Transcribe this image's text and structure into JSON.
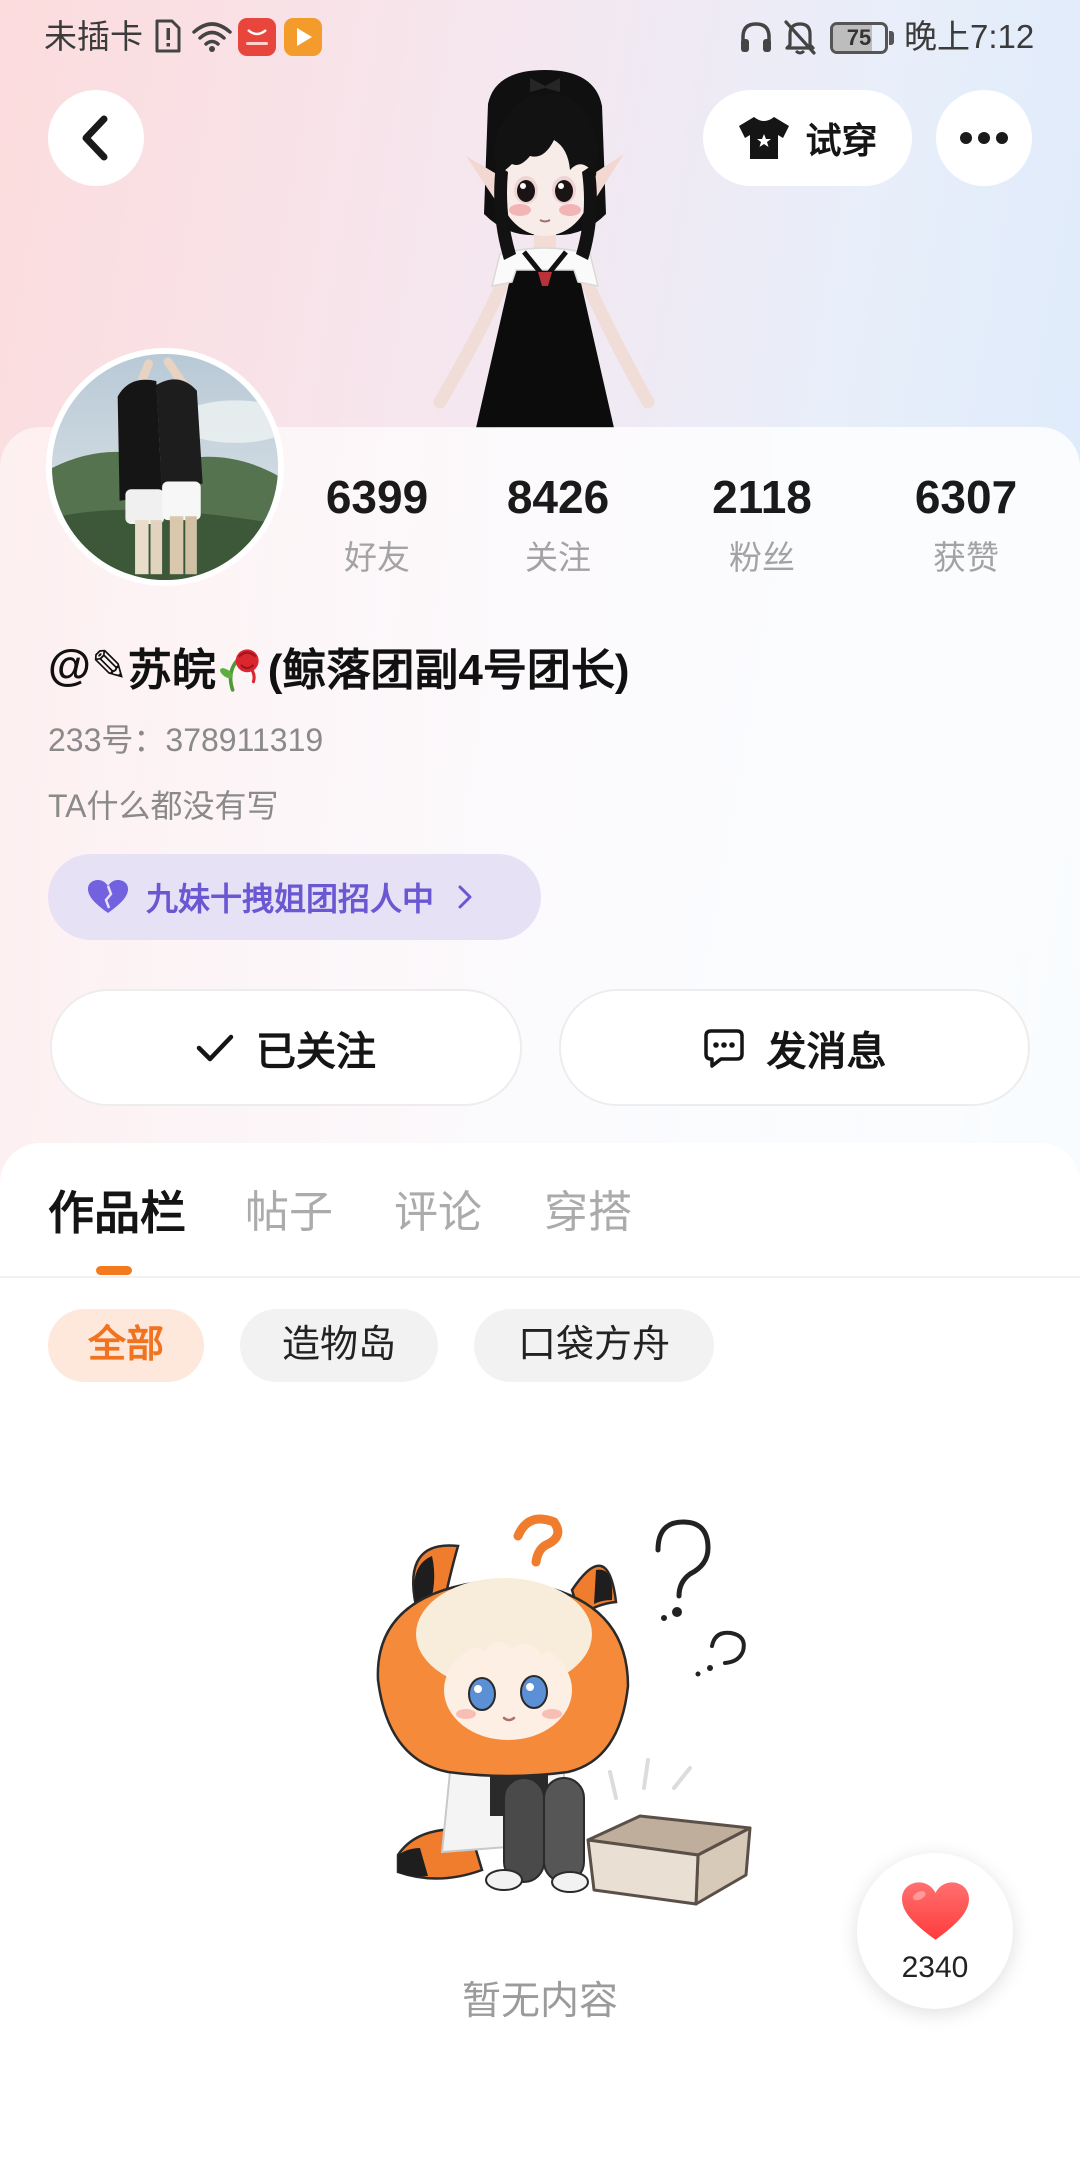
{
  "status_bar": {
    "carrier": "未插卡",
    "battery_level": "75",
    "time": "晚上7:12",
    "left_icons": [
      "sim-alert-icon",
      "wifi-icon",
      "huawei-appgallery-icon",
      "video-app-icon"
    ],
    "right_icons": [
      "headphones-icon",
      "notifications-off-icon",
      "battery-icon"
    ]
  },
  "header": {
    "back_icon": "chevron-left-icon",
    "try_on": {
      "icon": "tshirt-icon",
      "label": "试穿"
    },
    "more_icon": "more-dots-icon"
  },
  "profile": {
    "stats": [
      {
        "value": "6399",
        "label": "好友"
      },
      {
        "value": "8426",
        "label": "关注"
      },
      {
        "value": "2118",
        "label": "粉丝"
      },
      {
        "value": "6307",
        "label": "获赞"
      }
    ],
    "name": {
      "at": "@",
      "pencil": "✎",
      "main": "苏皖",
      "rose_icon": "wilted-rose-icon",
      "suffix": "(鲸落团副4号团长)"
    },
    "id_line": "233号：378911319",
    "bio": "TA什么都没有写",
    "group_tag": {
      "icon": "heart-group-icon",
      "label": "九妹十拽姐团招人中"
    },
    "follow_button": {
      "icon": "check-icon",
      "label": "已关注"
    },
    "message_button": {
      "icon": "chat-bubble-icon",
      "label": "发消息"
    }
  },
  "tabs": [
    {
      "label": "作品栏",
      "active": true
    },
    {
      "label": "帖子",
      "active": false
    },
    {
      "label": "评论",
      "active": false
    },
    {
      "label": "穿搭",
      "active": false
    }
  ],
  "filters": [
    {
      "label": "全部",
      "active": true
    },
    {
      "label": "造物岛",
      "active": false
    },
    {
      "label": "口袋方舟",
      "active": false
    }
  ],
  "empty_state": {
    "text": "暂无内容",
    "illustration": "empty-box-illustration"
  },
  "like_fab": {
    "icon": "heart-icon",
    "count": "2340"
  },
  "colors": {
    "accent": "#f47a1f",
    "tag_purple": "#6a58d3",
    "tag_bg": "#e7e1f6",
    "like_red": "#ff4b4b"
  }
}
